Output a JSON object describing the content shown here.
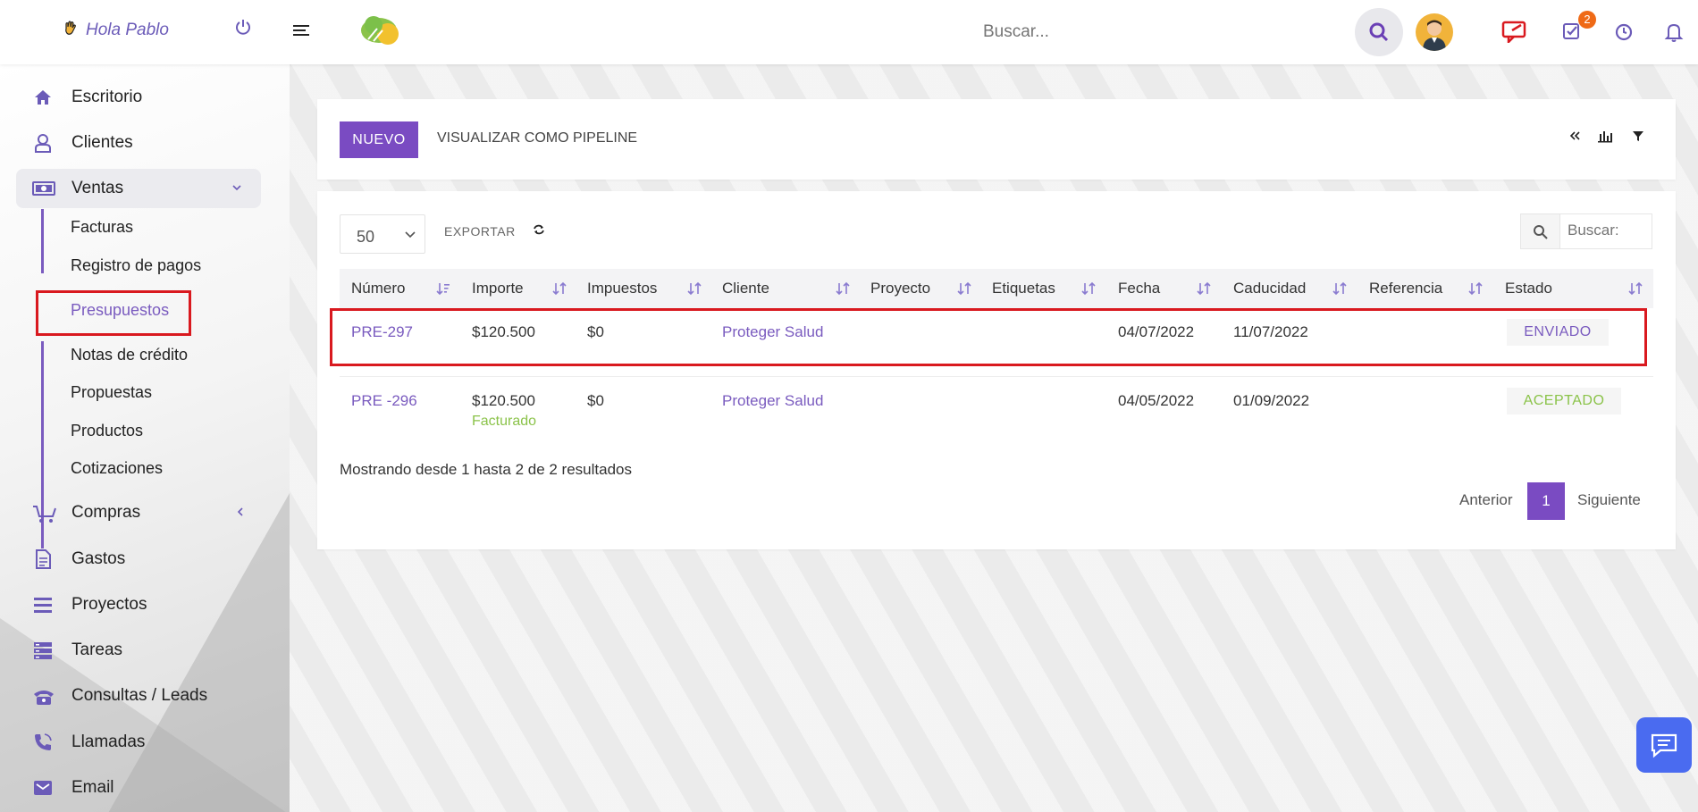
{
  "topbar": {
    "greeting": "Hola Pablo",
    "search_placeholder": "Buscar...",
    "tasks_badge": "2",
    "icons": [
      "hand-icon",
      "power-icon",
      "menu-icon",
      "logo",
      "search-icon",
      "avatar",
      "messages-icon",
      "tasks-icon",
      "clock-icon",
      "bell-icon"
    ]
  },
  "sidebar": {
    "items": [
      {
        "label": "Escritorio",
        "icon": "home-icon"
      },
      {
        "label": "Clientes",
        "icon": "user-icon"
      },
      {
        "label": "Ventas",
        "icon": "money-icon"
      },
      {
        "label": "Compras",
        "icon": "cart-icon"
      },
      {
        "label": "Gastos",
        "icon": "file-icon"
      },
      {
        "label": "Proyectos",
        "icon": "list-icon"
      },
      {
        "label": "Tareas",
        "icon": "tasks-icon"
      },
      {
        "label": "Consultas / Leads",
        "icon": "phone-icon"
      },
      {
        "label": "Llamadas",
        "icon": "phone-call-icon"
      },
      {
        "label": "Email",
        "icon": "email-icon"
      }
    ],
    "ventas_sub": [
      "Facturas",
      "Registro de pagos",
      "Presupuestos",
      "Notas de crédito",
      "Propuestas",
      "Productos",
      "Cotizaciones"
    ]
  },
  "toolbar": {
    "new_label": "NUEVO",
    "pipeline_label": "VISUALIZAR COMO PIPELINE",
    "icons": [
      "collapse-icon",
      "chart-icon",
      "filter-icon"
    ]
  },
  "table": {
    "page_size": "50",
    "export_label": "EXPORTAR",
    "search_placeholder": "Buscar:",
    "columns": [
      "Número",
      "Importe",
      "Impuestos",
      "Cliente",
      "Proyecto",
      "Etiquetas",
      "Fecha",
      "Caducidad",
      "Referencia",
      "Estado"
    ],
    "rows": [
      {
        "numero": "PRE-297",
        "importe": "$120.500",
        "importe_sub": "",
        "impuestos": "$0",
        "cliente": "Proteger Salud",
        "proyecto": "",
        "etiquetas": "",
        "fecha": "04/07/2022",
        "caducidad": "11/07/2022",
        "referencia": "",
        "estado": "ENVIADO"
      },
      {
        "numero": "PRE -296",
        "importe": "$120.500",
        "importe_sub": "Facturado",
        "impuestos": "$0",
        "cliente": "Proteger Salud",
        "proyecto": "",
        "etiquetas": "",
        "fecha": "04/05/2022",
        "caducidad": "01/09/2022",
        "referencia": "",
        "estado": "ACEPTADO"
      }
    ],
    "showing": "Mostrando desde 1 hasta 2 de 2 resultados",
    "pager": {
      "prev": "Anterior",
      "current": "1",
      "next": "Siguiente"
    }
  },
  "colors": {
    "accent": "#7a4bc2",
    "link": "#7a5bbf",
    "accepted": "#8bc34a",
    "highlight": "#d9191f",
    "chat": "#4a6bf0"
  }
}
